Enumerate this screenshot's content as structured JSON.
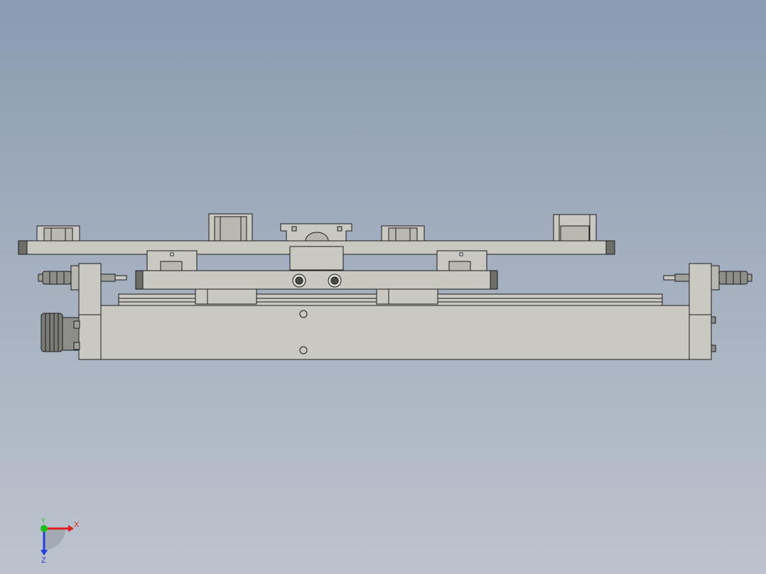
{
  "viewport": {
    "background_top": "#8b9bb0",
    "background_bottom": "#bcc3cd",
    "part_fill": "#c9c9c1",
    "part_shadow": "#a9a9a1",
    "edge_color": "#1a1a1a",
    "end_cap_color": "#6e6e68"
  },
  "triad": {
    "x_label": "X",
    "y_label": "Y",
    "z_label": "Z",
    "x_color": "#e02020",
    "y_color": "#18c018",
    "z_color": "#2040e0"
  }
}
